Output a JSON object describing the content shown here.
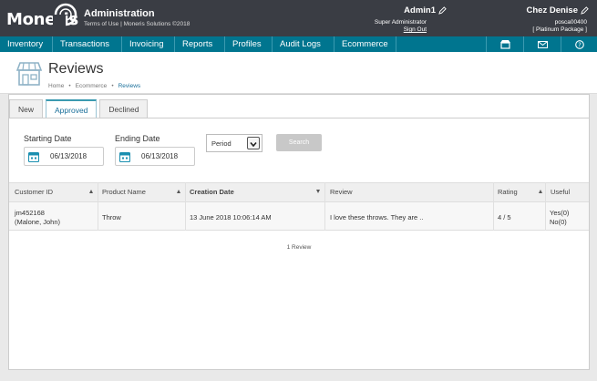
{
  "header": {
    "logo_text": "Moneris",
    "app_title": "Administration",
    "sub_links": "Terms of Use | Moneris Solutions ©2018",
    "user": {
      "name": "Admin1",
      "role": "Super Administrator",
      "signout": "Sign Out"
    },
    "store": {
      "name": "Chez  Denise",
      "id": "posca00400",
      "package": "[ Platinum Package ]"
    }
  },
  "nav": {
    "items": [
      "Inventory",
      "Transactions",
      "Invoicing",
      "Reports",
      "Profiles",
      "Audit Logs",
      "Ecommerce"
    ],
    "icons": [
      "store-icon",
      "mail-icon",
      "help-icon"
    ]
  },
  "page": {
    "title": "Reviews",
    "breadcrumb": [
      "Home",
      "Ecommerce",
      "Reviews"
    ]
  },
  "tabs": [
    "New",
    "Approved",
    "Declined"
  ],
  "active_tab": "Approved",
  "filters": {
    "start_label": "Starting Date",
    "start_value": "06/13/2018",
    "end_label": "Ending Date",
    "end_value": "06/13/2018",
    "period_value": "Period",
    "search_label": "Search"
  },
  "table": {
    "columns": [
      "Customer ID",
      "Product Name",
      "Creation Date",
      "Review",
      "Rating",
      "Useful"
    ],
    "rows": [
      {
        "customer_id": "jm452168",
        "customer_name": "(Malone, John)",
        "product": "Throw",
        "date": "13 June 2018 10:06:14 AM",
        "review": "I love these throws. They are ..",
        "rating": "4 / 5",
        "useful_yes": "Yes(0)",
        "useful_no": "No(0)"
      }
    ],
    "count_text": "1 Review"
  },
  "colors": {
    "header_bg": "#3a3d44",
    "nav_bg": "#00758f",
    "accent": "#1a6f9a"
  }
}
